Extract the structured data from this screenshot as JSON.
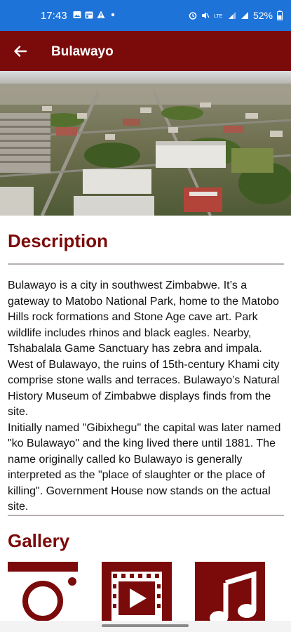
{
  "status_bar": {
    "time": "17:43",
    "battery": "52%",
    "left_icons": [
      "image-icon",
      "calendar-icon",
      "warning-icon",
      "dot-icon"
    ],
    "right_icons": [
      "alarm-icon",
      "mute-icon",
      "lte-icon",
      "signal-icon",
      "signal-icon",
      "battery-icon"
    ],
    "background": "#1e73d9"
  },
  "app_bar": {
    "title": "Bulawayo",
    "back_icon": "arrow-left-icon",
    "background": "#7b0a0a"
  },
  "hero": {
    "description": "aerial view of city"
  },
  "description_section": {
    "heading": "Description",
    "text": "Bulawayo is a city in southwest Zimbabwe. It’s a gateway to Matobo National Park, home to the Matobo Hills rock formations and Stone Age cave art. Park wildlife includes rhinos and black eagles. Nearby, Tshabalala Game Sanctuary has zebra and impala. West of Bulawayo, the ruins of 15th-century Khami city comprise stone walls and terraces. Bulawayo’s Natural History Museum of Zimbabwe displays finds from the site.\nInitially named \"Gibixhegu\" the capital was later named \"ko Bulawayo\" and the king lived there until 1881. The name originally called ko Bulawayo is generally interpreted as the \"place of slaughter or the place of killing\". Government House now stands on the actual site."
  },
  "gallery_section": {
    "heading": "Gallery",
    "tiles": [
      {
        "icon": "camera-icon"
      },
      {
        "icon": "video-film-icon"
      },
      {
        "icon": "music-note-icon"
      }
    ]
  },
  "colors": {
    "accent": "#7b0a0a",
    "divider": "#b8b0b0"
  }
}
